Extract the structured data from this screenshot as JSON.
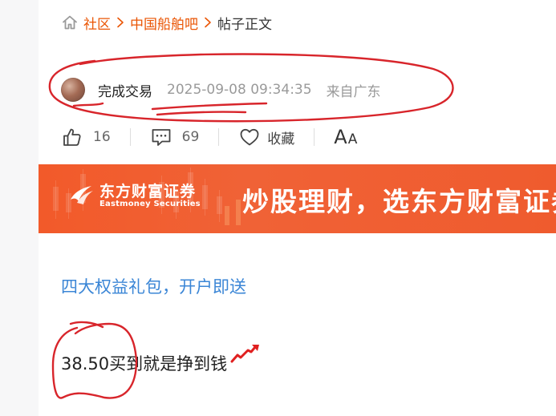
{
  "breadcrumb": {
    "items": [
      "社区",
      "中国船舶吧"
    ],
    "current": "帖子正文"
  },
  "author": {
    "name": "完成交易",
    "time": "2025-09-08 09:34:35",
    "location": "来自广东"
  },
  "actions": {
    "likes": "16",
    "comments": "69",
    "favorite_label": "收藏",
    "font_big": "A",
    "font_small": "A"
  },
  "banner": {
    "logo_cn": "东方财富证券",
    "logo_en": "Eastmoney Securities",
    "slogan": "炒股理财，选东方财富证券"
  },
  "promo": {
    "text": "四大权益礼包，开户即送"
  },
  "post": {
    "body": "38.50买到就是挣到钱"
  },
  "colors": {
    "breadcrumb_link": "#ea5504",
    "banner_bg": "#f25a2a",
    "promo_link": "#3b86d6",
    "annotation": "#d8252b"
  },
  "icons": [
    "home-icon",
    "chevron-right-icon",
    "thumbs-up-icon",
    "comment-icon",
    "heart-icon",
    "rising-arrow-icon"
  ]
}
